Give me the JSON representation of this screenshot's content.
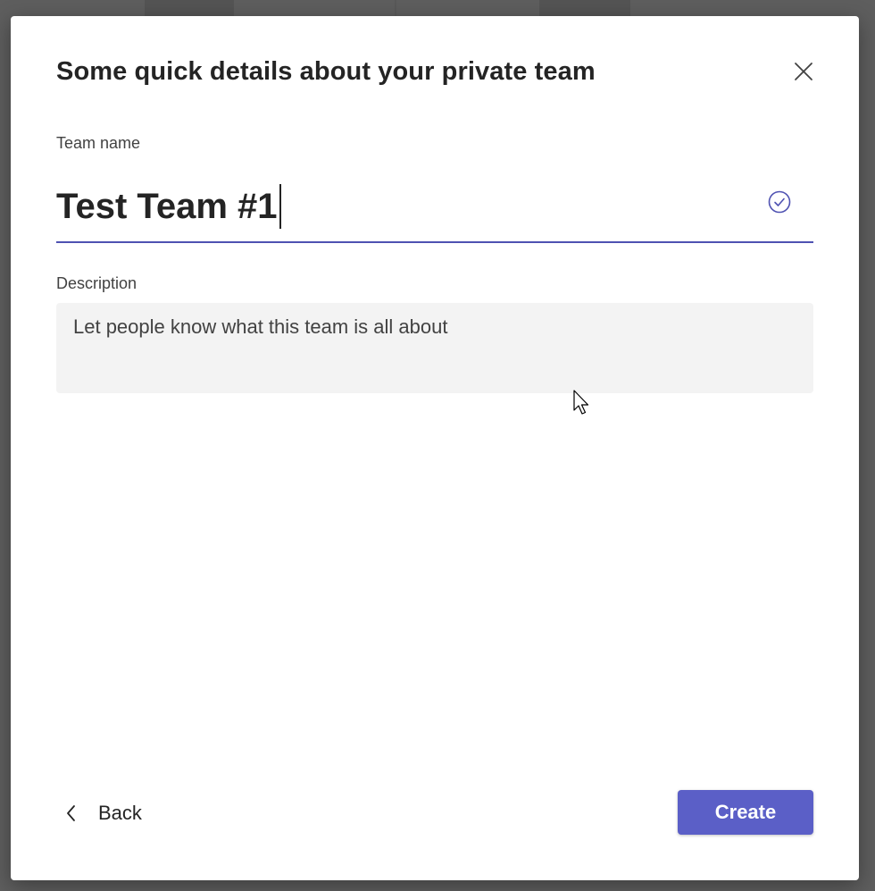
{
  "dialog": {
    "title": "Some quick details about your private team",
    "close_icon": "close-icon"
  },
  "team_name": {
    "label": "Team name",
    "value": "Test Team #1",
    "status_icon": "check-circle-icon"
  },
  "description": {
    "label": "Description",
    "placeholder": "Let people know what this team is all about",
    "value": ""
  },
  "footer": {
    "back_label": "Back",
    "back_icon": "chevron-left-icon",
    "create_label": "Create"
  },
  "colors": {
    "accent": "#5b5fc7",
    "underline": "#4f52b2",
    "backdrop": "#5e5e5e",
    "text": "#242424"
  }
}
